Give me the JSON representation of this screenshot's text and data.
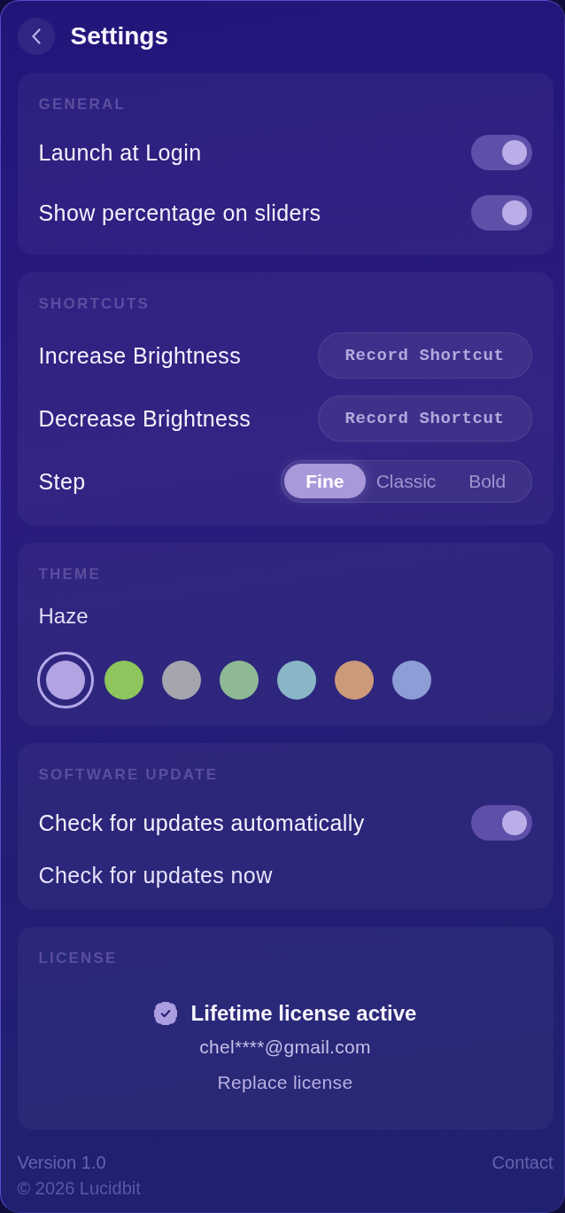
{
  "header": {
    "title": "Settings"
  },
  "general": {
    "heading": "GENERAL",
    "rows": [
      {
        "kind": "toggle",
        "label": "Launch at Login",
        "on": true
      },
      {
        "kind": "toggle",
        "label": "Show percentage on sliders",
        "on": true
      }
    ]
  },
  "shortcuts": {
    "heading": "SHORTCUTS",
    "rows": [
      {
        "kind": "shortcut",
        "label": "Increase Brightness",
        "button": "Record Shortcut"
      },
      {
        "kind": "shortcut",
        "label": "Decrease Brightness",
        "button": "Record Shortcut"
      },
      {
        "kind": "segmented",
        "label": "Step",
        "options": [
          {
            "label": "Fine",
            "selected": true
          },
          {
            "label": "Classic",
            "selected": false
          },
          {
            "label": "Bold",
            "selected": false
          }
        ]
      }
    ]
  },
  "theme": {
    "heading": "THEME",
    "name": "Haze",
    "swatches": [
      {
        "color": "#b2a4e2",
        "selected": true
      },
      {
        "color": "#8cc65c",
        "selected": false
      },
      {
        "color": "#a5a5ad",
        "selected": false
      },
      {
        "color": "#8fb994",
        "selected": false
      },
      {
        "color": "#88b6c6",
        "selected": false
      },
      {
        "color": "#cc9a79",
        "selected": false
      },
      {
        "color": "#8d9dd5",
        "selected": false
      }
    ]
  },
  "software_update": {
    "heading": "SOFTWARE UPDATE",
    "rows": [
      {
        "kind": "toggle",
        "label": "Check for updates automatically",
        "on": true
      },
      {
        "kind": "action",
        "label": "Check for updates now"
      }
    ]
  },
  "license": {
    "heading": "LICENSE",
    "status": "Lifetime license active",
    "email": "chel****@gmail.com",
    "action": "Replace license"
  },
  "footer": {
    "version": "Version 1.0",
    "contact": "Contact",
    "copyright": "© 2026 Lucidbit"
  }
}
